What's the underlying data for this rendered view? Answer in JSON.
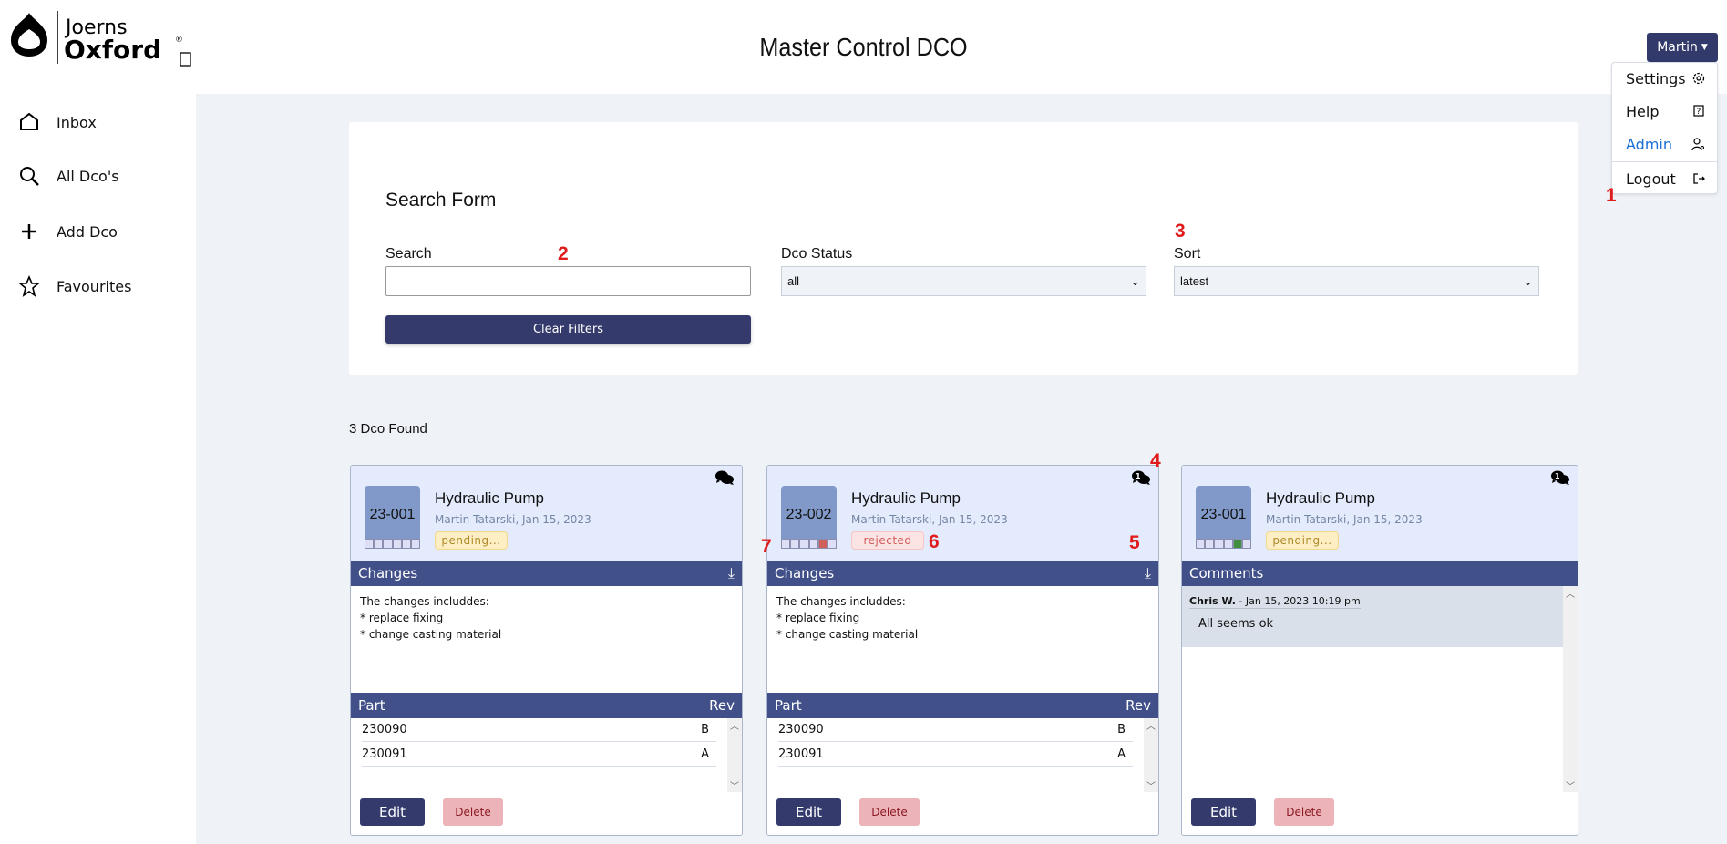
{
  "header": {
    "logo_text": "Joerns Oxford",
    "title": "Master Control DCO",
    "user": "Martin"
  },
  "user_menu": [
    {
      "label": "Settings",
      "icon": "gear-icon"
    },
    {
      "label": "Help",
      "icon": "help-icon"
    },
    {
      "label": "Admin",
      "icon": "admin-icon",
      "color": "#1a6fd6"
    },
    {
      "label": "Logout",
      "icon": "logout-icon"
    }
  ],
  "sidebar": [
    {
      "label": "Inbox",
      "icon": "home-icon"
    },
    {
      "label": "All Dco's",
      "icon": "search-icon"
    },
    {
      "label": "Add Dco",
      "icon": "plus-icon"
    },
    {
      "label": "Favourites",
      "icon": "star-icon"
    }
  ],
  "search_form": {
    "title": "Search Form",
    "search_label": "Search",
    "search_value": "",
    "status_label": "Dco Status",
    "status_value": "all",
    "sort_label": "Sort",
    "sort_value": "latest",
    "clear_label": "Clear Filters"
  },
  "results_count": "3 Dco Found",
  "cards": [
    {
      "id": "23-001",
      "title": "Hydraulic Pump",
      "meta": "Martin Tatarski,  Jan 15, 2023",
      "status": "pending...",
      "status_type": "pending",
      "active_step": -1,
      "step_color": "",
      "comment_count": "",
      "section": "Changes",
      "changes": "The changes includdes:\n* replace fixing\n* change casting material",
      "part_header": "Part",
      "rev_header": "Rev",
      "parts": [
        {
          "part": "230090",
          "rev": "B"
        },
        {
          "part": "230091",
          "rev": "A"
        }
      ],
      "edit": "Edit",
      "delete": "Delete"
    },
    {
      "id": "23-002",
      "title": "Hydraulic Pump",
      "meta": "Martin Tatarski,  Jan 15, 2023",
      "status": "rejected",
      "status_type": "rejected",
      "active_step": 4,
      "step_color": "#d0605a",
      "comment_count": "1",
      "section": "Changes",
      "changes": "The changes includdes:\n* replace fixing\n* change casting material",
      "part_header": "Part",
      "rev_header": "Rev",
      "parts": [
        {
          "part": "230090",
          "rev": "B"
        },
        {
          "part": "230091",
          "rev": "A"
        }
      ],
      "edit": "Edit",
      "delete": "Delete"
    },
    {
      "id": "23-001",
      "title": "Hydraulic Pump",
      "meta": "Martin Tatarski,  Jan 15, 2023",
      "status": "pending...",
      "status_type": "pending",
      "active_step": 4,
      "step_color": "#3f8f3f",
      "comment_count": "1",
      "section": "Comments",
      "comments": [
        {
          "author": "Chris W.",
          "date": " - Jan 15, 2023 10:19 pm",
          "text": "All seems ok"
        }
      ],
      "edit": "Edit",
      "delete": "Delete"
    }
  ],
  "annotations": [
    "1",
    "2",
    "3",
    "4",
    "5",
    "6",
    "7"
  ],
  "colors": {
    "primary": "#343b6c",
    "bar": "#415089",
    "card_head": "#e4ebfc",
    "background": "#eff2f7"
  }
}
